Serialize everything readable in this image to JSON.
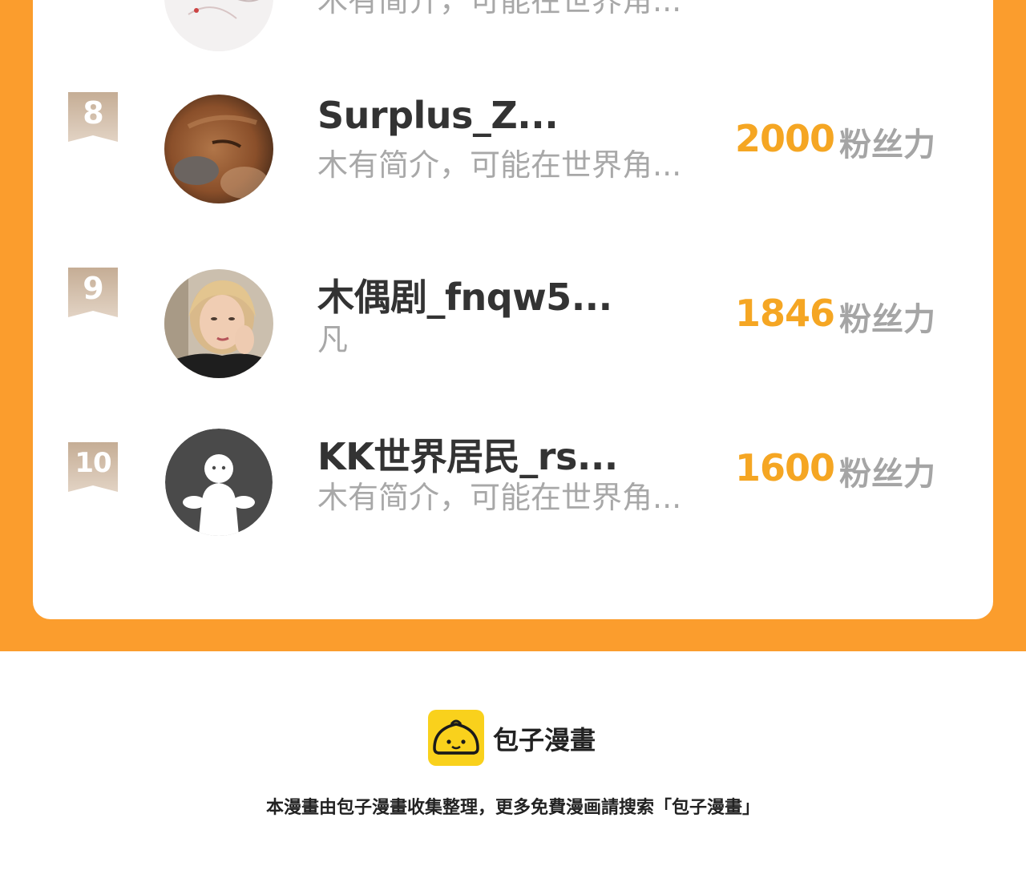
{
  "leaderboard": {
    "unit_label": "粉丝力",
    "partial_row": {
      "bio": "木有简介，可能在世界角..."
    },
    "entries": [
      {
        "rank": "8",
        "name": "Surplus_Z...",
        "bio": "木有简介，可能在世界角...",
        "score": "2000",
        "avatar": "dog-photo"
      },
      {
        "rank": "9",
        "name": "木偶剧_fnqw5...",
        "bio": "凡",
        "score": "1846",
        "avatar": "person-photo"
      },
      {
        "rank": "10",
        "name": "KK世界居民_rs...",
        "bio": "木有简介，可能在世界角...",
        "score": "1600",
        "avatar": "default-avatar-icon"
      }
    ]
  },
  "footer": {
    "brand": "包子漫畫",
    "notice": "本漫畫由包子漫畫收集整理，更多免費漫画請搜索「包子漫畫」",
    "logo_icon": "bun-logo-icon"
  },
  "colors": {
    "frame": "#fb9d2d",
    "score": "#f5a623",
    "badge": "#c9b39c",
    "logo_bg": "#f9d11c"
  }
}
